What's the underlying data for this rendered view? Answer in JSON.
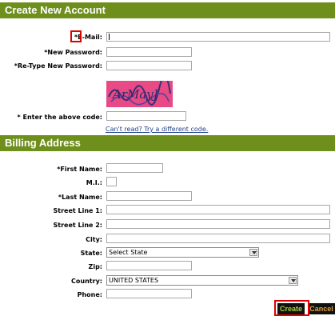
{
  "account": {
    "header": "Create New Account",
    "email_label": "*E-Mail:",
    "new_password_label": "*New Password:",
    "retype_password_label": "*Re-Type New Password:",
    "code_label": "* Enter the above code:",
    "captcha_text": "ArMayJ",
    "cant_read_link": "Can't read? Try a different code."
  },
  "billing": {
    "header": "Billing Address",
    "first_name_label": "*First Name:",
    "mi_label": "M.I.:",
    "last_name_label": "*Last Name:",
    "street1_label": "Street Line 1:",
    "street2_label": "Street Line 2:",
    "city_label": "City:",
    "state_label": "State:",
    "state_value": "Select State",
    "zip_label": "Zip:",
    "country_label": "Country:",
    "country_value": "UNITED STATES",
    "phone_label": "Phone:"
  },
  "buttons": {
    "create": "Create",
    "cancel": "Cancel"
  },
  "colors": {
    "header_bg": "#6f8f1d",
    "highlight": "#e00000",
    "create_text": "#a8d43a",
    "cancel_text": "#e0a040"
  }
}
